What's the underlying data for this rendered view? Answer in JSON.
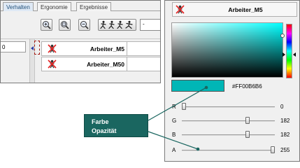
{
  "tabs": [
    {
      "label": "Verhalten",
      "active": true
    },
    {
      "label": "Ergonomie",
      "active": false
    },
    {
      "label": "Ergebnisse",
      "active": false
    }
  ],
  "toolbar": {
    "buttons": [
      "zoom-in-icon",
      "zoom-fit-icon",
      "zoom-out-icon",
      "walking-figures-icon"
    ],
    "input_value": "-"
  },
  "list": {
    "previous_column_value": "0",
    "rows": [
      {
        "name": "Arbeiter_M5",
        "icon": "worker-disabled-icon"
      },
      {
        "name": "Arbeiter_M50",
        "icon": "worker-disabled-icon"
      }
    ]
  },
  "color_panel": {
    "title": "Arbeiter_M5",
    "selected_hue": "cyan",
    "hex": "#FF00B6B6",
    "swatch_color": "#00B6B6",
    "sliders": [
      {
        "label": "R",
        "value": 0
      },
      {
        "label": "G",
        "value": 182
      },
      {
        "label": "B",
        "value": 182
      },
      {
        "label": "A",
        "value": 255
      }
    ]
  },
  "callout": {
    "line1": "Farbe",
    "line2": "Opazität",
    "color": "#1a6660"
  },
  "colors": {
    "active_tab": "#dfe9f5",
    "selection_marker": "#a31a12",
    "scroll_arrow": "#2a3da8"
  }
}
